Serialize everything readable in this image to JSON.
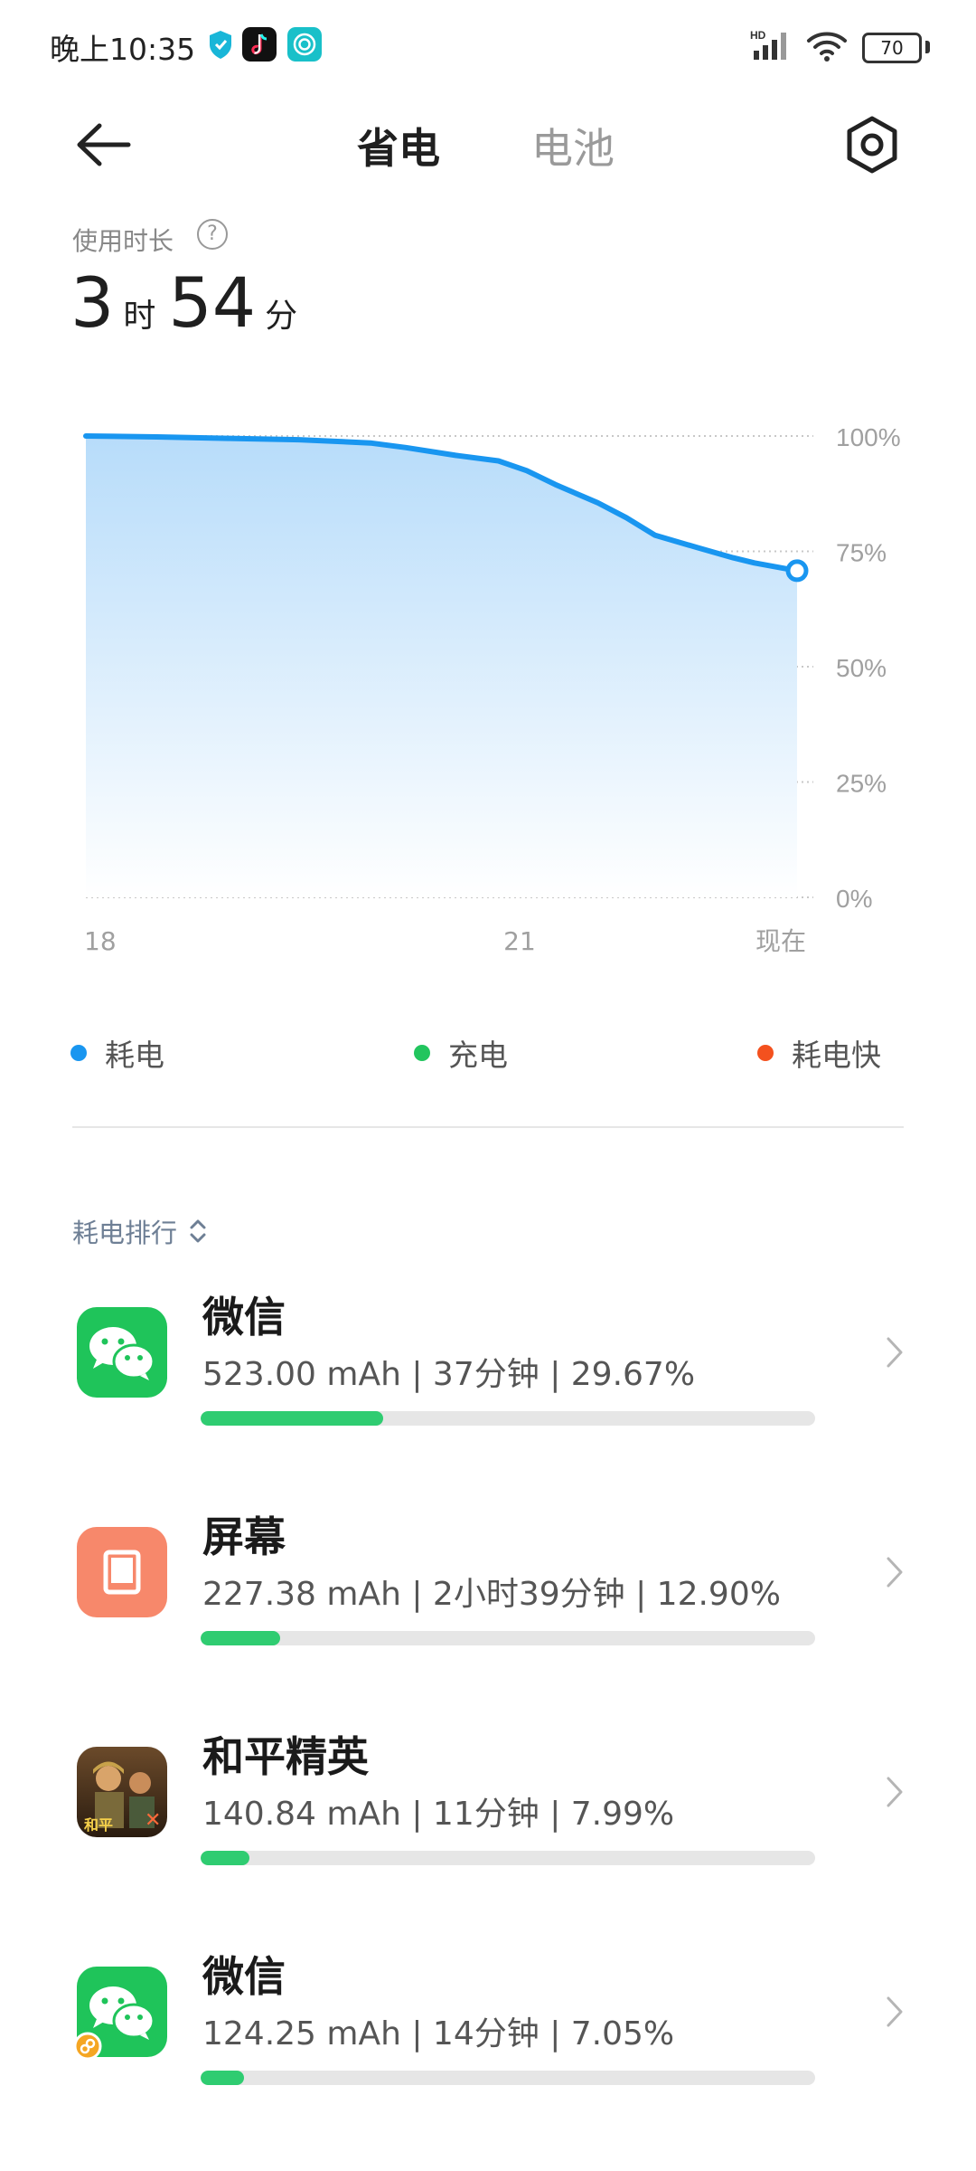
{
  "status_bar": {
    "time": "晚上10:35",
    "battery_level": "70",
    "network": "HD"
  },
  "header": {
    "tab_active": "省电",
    "tab_inactive": "电池"
  },
  "usage": {
    "label": "使用时长",
    "help_symbol": "?",
    "hours": "3",
    "hours_unit": "时",
    "minutes": "54",
    "minutes_unit": "分"
  },
  "chart_data": {
    "type": "area",
    "x_tick_labels": [
      "18",
      "21",
      "现在"
    ],
    "y_tick_labels": [
      "100%",
      "75%",
      "50%",
      "25%",
      "0%"
    ],
    "ylim": [
      0,
      100
    ],
    "grid": true,
    "series": [
      {
        "values": [
          100,
          99.8,
          99.5,
          99.2,
          98.5,
          97.5,
          95.8,
          94.6,
          92.5,
          89.5,
          85.5,
          82.3,
          78.5,
          75.8,
          73.6,
          72.5,
          70.8
        ]
      }
    ],
    "x_fraction": [
      0.0,
      0.1,
      0.2,
      0.3,
      0.4,
      0.45,
      0.52,
      0.58,
      0.62,
      0.66,
      0.72,
      0.76,
      0.8,
      0.86,
      0.91,
      0.94,
      1.0
    ],
    "end_value": 71,
    "colors": {
      "line": "#1996f0",
      "fill_top": "#b7dcfa",
      "fill_bottom": "#ffffff"
    }
  },
  "legend": [
    {
      "label": "耗电",
      "color": "#1996f0"
    },
    {
      "label": "充电",
      "color": "#22c55e"
    },
    {
      "label": "耗电快",
      "color": "#f4511e"
    }
  ],
  "ranking": {
    "title": "耗电排行",
    "items": [
      {
        "name": "微信",
        "stats": "523.00 mAh | 37分钟 | 29.67%",
        "percent": 29.67,
        "icon": "wechat-icon"
      },
      {
        "name": "屏幕",
        "stats": "227.38 mAh | 2小时39分钟 | 12.90%",
        "percent": 12.9,
        "icon": "screen-icon"
      },
      {
        "name": "和平精英",
        "stats": "140.84 mAh | 11分钟 | 7.99%",
        "percent": 7.99,
        "icon": "game-icon"
      },
      {
        "name": "微信",
        "stats": "124.25 mAh | 14分钟 | 7.05%",
        "percent": 7.05,
        "icon": "wechat-dual-icon"
      }
    ]
  },
  "colors": {
    "accent_green": "#2fcc71",
    "wechat_green": "#1fc45a",
    "screen_orange": "#f7886b"
  }
}
